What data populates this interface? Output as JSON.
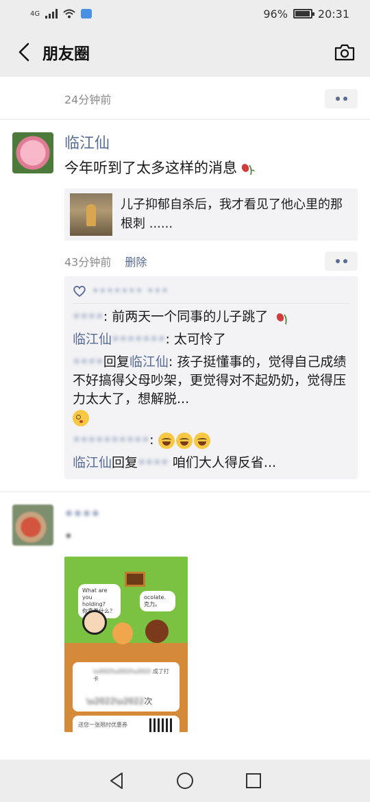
{
  "status_bar": {
    "network": "4G",
    "battery": "96%",
    "battery_level": 0.96,
    "time": "20:31"
  },
  "header": {
    "title": "朋友圈"
  },
  "prev_post": {
    "time": "24分钟前"
  },
  "post1": {
    "author": "临江仙",
    "text": "今年听到了太多这样的消息",
    "link_title": "儿子抑郁自杀后，我才看见了他心里的那根刺 ......",
    "time": "43分钟前",
    "delete_label": "删除",
    "likes_text": "••••••• •••",
    "comments": [
      {
        "name_blur": "••••",
        "sep": ": ",
        "text": "前两天一个同事的儿子跳了"
      },
      {
        "name": "临江仙",
        "reply_blur": "•••••••",
        "sep": ": ",
        "text": "太可怜了"
      },
      {
        "name_blur": "••••",
        "reply_word": "回复",
        "reply_name": "临江仙",
        "sep": ": ",
        "text": "孩子挺懂事的，觉得自己成绩不好搞得父母吵架，更觉得对不起奶奶，觉得压力太大了，想解脱..."
      },
      {
        "name_blur": "••••••••••",
        "sep": ": "
      },
      {
        "name": "临江仙",
        "reply_word": "回复",
        "reply_blur": "••••",
        "text": " 咱们大人得反省..."
      }
    ]
  },
  "post2": {
    "author_blur": "••••",
    "text_blur": "•",
    "poster": {
      "bubble1_en": "What are you holding?",
      "bubble1_cn": "你拿着什么？",
      "bubble2_en": "ocolate.",
      "bubble2_cn": "克力。",
      "card1_label": "成了打卡",
      "card1_unit": "次",
      "card2_text": "送您一张限时优惠券"
    }
  },
  "colors": {
    "link_blue": "#576b95",
    "bar_gray": "#ededed",
    "card_bg": "#f3f3f5"
  },
  "icons": {
    "back": "chevron-left-icon",
    "camera": "camera-icon",
    "heart": "heart-icon",
    "rose": "wilted-rose-icon",
    "more": "more-dots-icon"
  }
}
